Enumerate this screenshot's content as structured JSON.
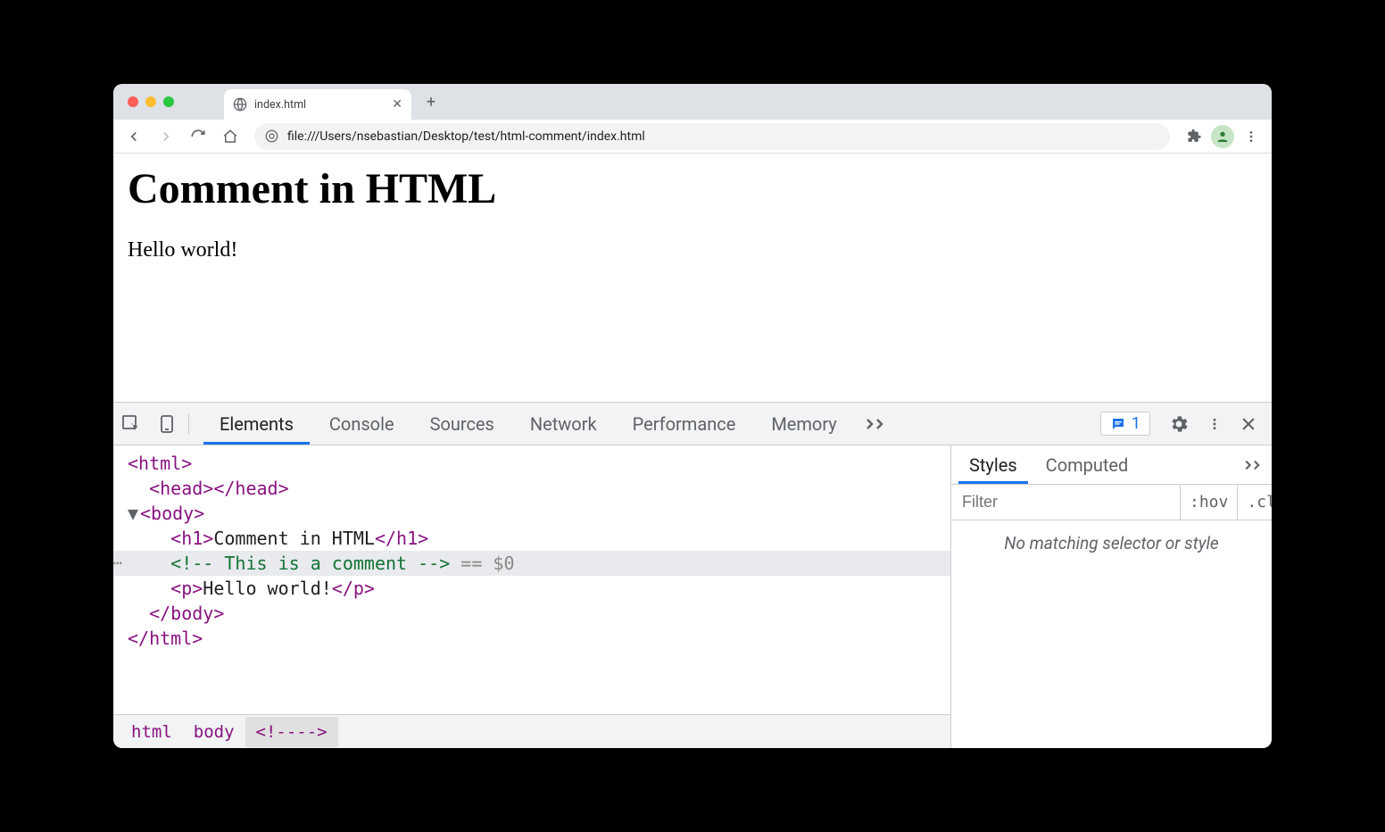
{
  "browser": {
    "tab": {
      "title": "index.html"
    },
    "url": "file:///Users/nsebastian/Desktop/test/html-comment/index.html"
  },
  "page": {
    "heading": "Comment in HTML",
    "paragraph": "Hello world!"
  },
  "devtools": {
    "tabs": [
      "Elements",
      "Console",
      "Sources",
      "Network",
      "Performance",
      "Memory"
    ],
    "issues_count": "1",
    "dom": {
      "html_open": "<html>",
      "head": "<head></head>",
      "body_open": "<body>",
      "h1_open": "<h1>",
      "h1_text": "Comment in HTML",
      "h1_close": "</h1>",
      "comment": "<!-- This is a comment -->",
      "sel_annot": " == $0",
      "p_open": "<p>",
      "p_text": "Hello world!",
      "p_close": "</p>",
      "body_close": "</body>",
      "html_close": "</html>"
    },
    "breadcrumbs": [
      "html",
      "body",
      "<!--​-->"
    ],
    "styles": {
      "tabs": [
        "Styles",
        "Computed"
      ],
      "filter_placeholder": "Filter",
      "hov": ":hov",
      "cls": ".cls",
      "empty_message": "No matching selector or style"
    }
  }
}
